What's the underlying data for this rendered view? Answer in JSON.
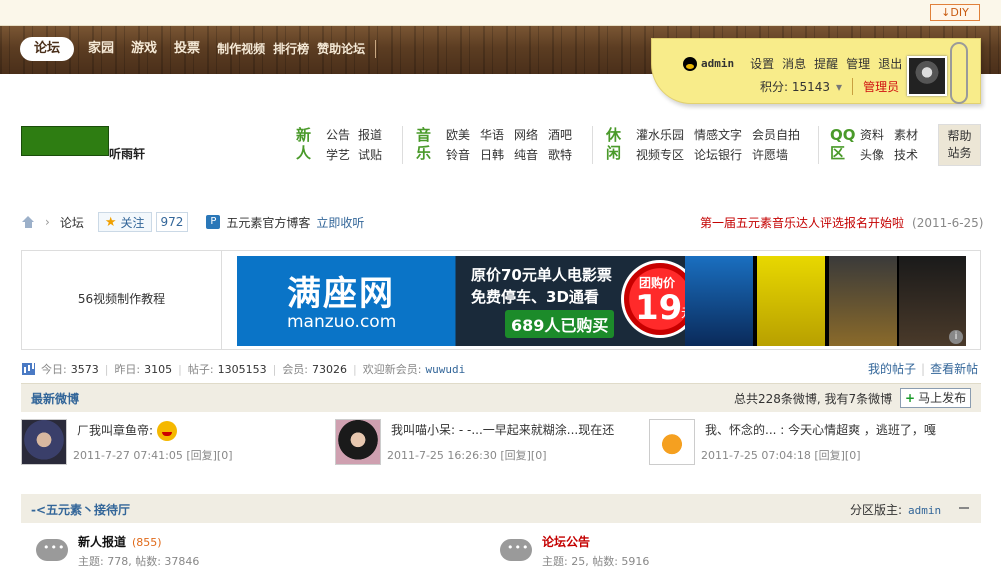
{
  "topbar": {
    "diy_label": "↓DIY"
  },
  "nav": {
    "items": [
      "论坛",
      "家园",
      "游戏",
      "投票",
      "制作视频",
      "排行榜",
      "赞助论坛"
    ]
  },
  "user": {
    "name": "admin",
    "links": [
      "设置",
      "消息",
      "提醒",
      "管理",
      "退出"
    ],
    "score_label": "积分: 15143",
    "score_arrow": "▾",
    "role": "管理员"
  },
  "site": {
    "name": "听雨轩"
  },
  "quicklinks": [
    {
      "title": [
        "新",
        "人"
      ],
      "links": [
        "公告",
        "报道",
        "学艺",
        "试贴"
      ],
      "cols": 2
    },
    {
      "title": [
        "音",
        "乐"
      ],
      "links": [
        "欧美",
        "华语",
        "网络",
        "酒吧",
        "铃音",
        "日韩",
        "纯音",
        "歌特"
      ],
      "cols": 4
    },
    {
      "title": [
        "休",
        "闲"
      ],
      "links": [
        "灌水乐园",
        "情感文字",
        "会员自拍",
        "视频专区",
        "论坛银行",
        "许愿墙"
      ],
      "cols": 3
    },
    {
      "title": [
        "QQ",
        "区"
      ],
      "links": [
        "资料",
        "素材",
        "头像",
        "技术"
      ],
      "cols": 2
    }
  ],
  "help": {
    "line1": "帮助",
    "line2": "站务"
  },
  "breadcrumb": {
    "current": "论坛",
    "follow_label": "关注",
    "follow_count": "972",
    "blog_icon": "P",
    "blog_label": "五元素官方博客",
    "collect_label": "立即收听"
  },
  "notice": {
    "text": "第一届五元素音乐达人评选报名开始啦",
    "date": "(2011-6-25)"
  },
  "ad": {
    "left_text": "56视频制作教程",
    "banner": {
      "brand": "满座网",
      "domain": "manzuo.com",
      "line1": "原价70元单人电影票",
      "line2": "免费停车、3D通看",
      "bought": "689人已购买",
      "group_price_label": "团购价",
      "price": "19",
      "unit": "元",
      "info": "i"
    }
  },
  "stats": {
    "today_label": "今日:",
    "today": "3573",
    "yesterday_label": "昨日:",
    "yesterday": "3105",
    "posts_label": "帖子:",
    "posts": "1305153",
    "members_label": "会员:",
    "members": "73026",
    "newmember_label": "欢迎新会员:",
    "newmember": "wuwudi",
    "my_posts": "我的帖子",
    "new_posts": "查看新帖"
  },
  "weibo": {
    "title": "最新微博",
    "total": "总共228条微博, 我有7条微博",
    "publish": "马上发布",
    "posts": [
      {
        "text": "ㄏ我叫章鱼帝:",
        "meta": "2011-7-27 07:41:05 [回复][0]"
      },
      {
        "text": "我叫喵小呆: - -...一早起来就糊涂...现在还",
        "meta": "2011-7-25 16:26:30 [回复][0]"
      },
      {
        "text": "我、怀念的...  : 今天心情超爽  ，逃班了，嘎",
        "meta": "2011-7-25 07:04:18 [回复][0]"
      }
    ]
  },
  "area": {
    "title": "-<五元素丶接待厅",
    "moderator_label": "分区版主:",
    "moderator": "admin"
  },
  "forums": [
    {
      "name": "新人报道",
      "count": "(855)",
      "sub": "主题: 778, 帖数: 37846"
    },
    {
      "name": "论坛公告",
      "count": "",
      "sub": "主题: 25, 帖数: 5916"
    }
  ],
  "colors": {
    "accent": "#336699",
    "wood": "#5c3d22",
    "note": "#f8ec8a",
    "green": "#4a9a2a",
    "red": "#c40000"
  }
}
